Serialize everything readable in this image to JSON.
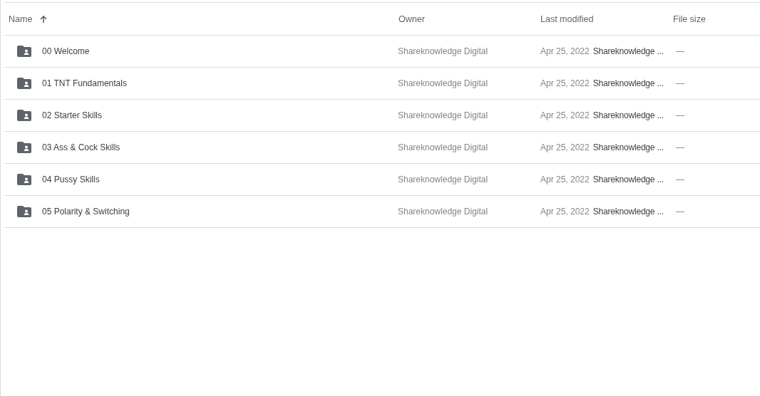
{
  "table": {
    "columns": [
      {
        "label": "Name",
        "sorted": true
      },
      {
        "label": "Owner",
        "sorted": false
      },
      {
        "label": "Last modified",
        "sorted": false
      },
      {
        "label": "File size",
        "sorted": false
      }
    ],
    "rows": [
      {
        "name": "00 Welcome",
        "owner": "Shareknowledge Digital",
        "date": "Apr 25, 2022",
        "modified_by": "Shareknowledge ...",
        "size": "—"
      },
      {
        "name": "01 TNT Fundamentals",
        "owner": "Shareknowledge Digital",
        "date": "Apr 25, 2022",
        "modified_by": "Shareknowledge ...",
        "size": "—"
      },
      {
        "name": "02 Starter Skills",
        "owner": "Shareknowledge Digital",
        "date": "Apr 25, 2022",
        "modified_by": "Shareknowledge ...",
        "size": "—"
      },
      {
        "name": "03 Ass & Cock Skills",
        "owner": "Shareknowledge Digital",
        "date": "Apr 25, 2022",
        "modified_by": "Shareknowledge ...",
        "size": "—"
      },
      {
        "name": "04 Pussy Skills",
        "owner": "Shareknowledge Digital",
        "date": "Apr 25, 2022",
        "modified_by": "Shareknowledge ...",
        "size": "—"
      },
      {
        "name": "05 Polarity & Switching",
        "owner": "Shareknowledge Digital",
        "date": "Apr 25, 2022",
        "modified_by": "Shareknowledge ...",
        "size": "—"
      }
    ]
  }
}
